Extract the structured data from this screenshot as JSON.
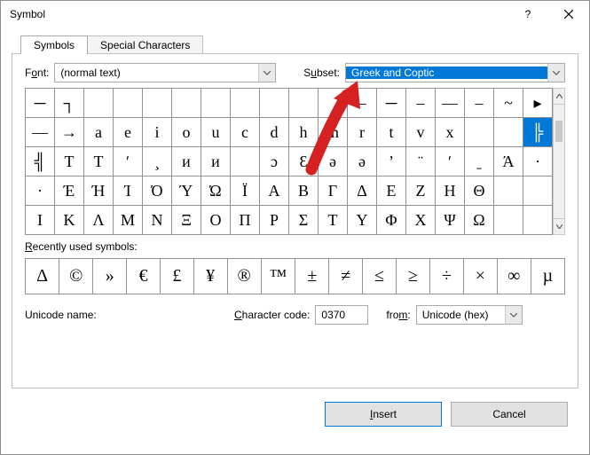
{
  "window": {
    "title": "Symbol"
  },
  "titlebar": {
    "help": "?",
    "close": "✕"
  },
  "tabs": {
    "symbols": "Symbols",
    "special": "Special Characters"
  },
  "labels": {
    "font_pre": "F",
    "font_und": "o",
    "font_post": "nt:",
    "subset_pre": "S",
    "subset_und": "u",
    "subset_post": "bset:",
    "recent_pre": "",
    "recent_und": "R",
    "recent_post": "ecently used symbols:",
    "uname": "Unicode name:",
    "charcode_und": "C",
    "charcode_post": "haracter code:",
    "from_pre": "fro",
    "from_und": "m",
    "from_post": ":"
  },
  "selects": {
    "font": "(normal text)",
    "subset": "Greek and Coptic",
    "from": "Unicode (hex)"
  },
  "charcode": "0370",
  "grid": [
    [
      "─",
      "┐",
      " ",
      " ",
      " ",
      " ",
      " ",
      " ",
      " ",
      " ",
      " ",
      "–",
      "─",
      "–",
      "—",
      "–",
      "~",
      "▸"
    ],
    [
      "—",
      "→",
      "a",
      "e",
      "i",
      "o",
      "u",
      "c",
      "d",
      "h",
      "m",
      "r",
      "t",
      "v",
      "x",
      "",
      "",
      "╠"
    ],
    [
      "╣",
      "Т",
      "T",
      "ʹ",
      "¸",
      "и",
      "и",
      " ",
      "ɔ",
      "Ɛ",
      "ə",
      "ə",
      "ʼ",
      "̈",
      "ʹ",
      "ˍ",
      "Ά",
      "·"
    ],
    [
      "·",
      "Έ",
      "Ή",
      "Ί",
      "Ό",
      "Ύ",
      "Ώ",
      "Ϊ",
      "Α",
      "Β",
      "Γ",
      "Δ",
      "Ε",
      "Ζ",
      "Η",
      "Θ",
      "",
      ""
    ],
    [
      "Ι",
      "Κ",
      "Λ",
      "Μ",
      "Ν",
      "Ξ",
      "Ο",
      "Π",
      "Ρ",
      "Σ",
      "Τ",
      "Υ",
      "Φ",
      "Χ",
      "Ψ",
      "Ω",
      "",
      ""
    ]
  ],
  "grid_cols": 18,
  "grid_rows": 5,
  "selected": {
    "row": 1,
    "col": 17
  },
  "recent": [
    "Δ",
    "©",
    "»",
    "€",
    "£",
    "¥",
    "®",
    "™",
    "±",
    "≠",
    "≤",
    "≥",
    "÷",
    "×",
    "∞",
    "µ"
  ],
  "buttons": {
    "insert_und": "I",
    "insert_post": "nsert",
    "cancel": "Cancel"
  }
}
